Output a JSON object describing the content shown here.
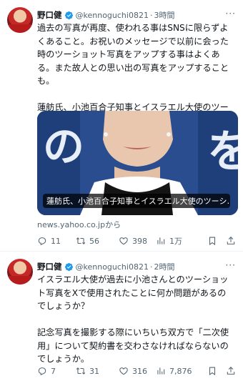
{
  "tweets": [
    {
      "name": "野口健",
      "handle": "@kennoguchi0821",
      "dot": "·",
      "time": "3時間",
      "text": "過去の写真が再度、使われる事はSNSに限らずよくあること。お祝いのメッセージで以前に会った時のツーショット写真をアップする事はよくある。また故人との思い出の写真をアップすることも。\n\n蓮舫氏、小池百合子知事とイスラエル大使のツーショットに疑念",
      "card_caption": "蓮舫氏、小池百合子知事とイスラエル大使のツーシ…",
      "source": "news.yahoo.co.jpから",
      "replies": "11",
      "retweets": "56",
      "likes": "398",
      "views": "1万"
    },
    {
      "name": "野口健",
      "handle": "@kennoguchi0821",
      "dot": "·",
      "time": "2時間",
      "text": "イスラエル大使が過去に小池さんとのツーショット写真をXで使用されたことに何か問題があるのでしょうか？\n\n記念写真を撮影する際にいちいち双方で「二次使用」について契約書を交わさなければならないのでしょうか。",
      "replies": "7",
      "retweets": "31",
      "likes": "316",
      "views": "7,876"
    }
  ],
  "more_label": "···",
  "colors": {
    "text": "#0f1419",
    "muted": "#536471",
    "verified": "#1d9bf0"
  }
}
